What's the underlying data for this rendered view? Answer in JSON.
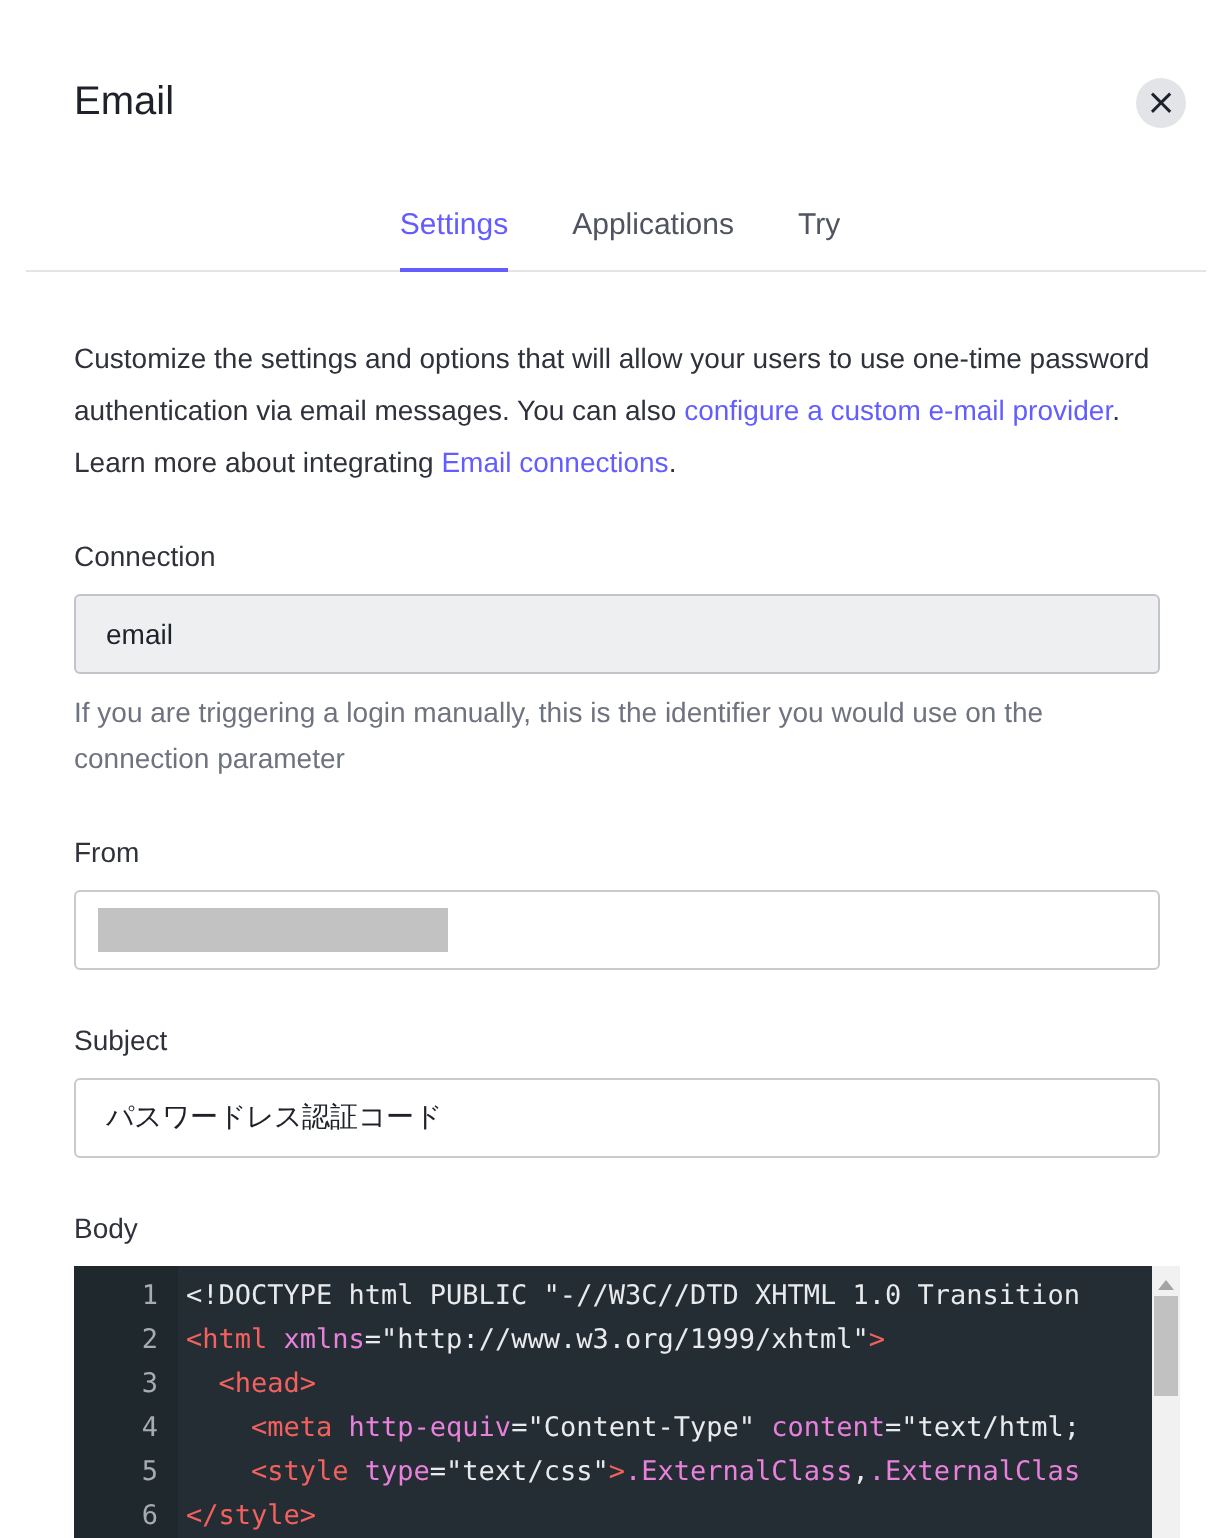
{
  "dialog": {
    "title": "Email",
    "close_label": "×"
  },
  "tabs": [
    {
      "label": "Settings",
      "selected": true
    },
    {
      "label": "Applications",
      "selected": false
    },
    {
      "label": "Try",
      "selected": false
    }
  ],
  "description": {
    "parts": [
      {
        "kind": "text",
        "text": "Customize the settings and options that will allow your users to use one-time password authentication via email messages. You can also "
      },
      {
        "kind": "link",
        "text": "configure a custom e-mail provider"
      },
      {
        "kind": "text",
        "text": ". Learn more about integrating "
      },
      {
        "kind": "link",
        "text": "Email connections"
      },
      {
        "kind": "text",
        "text": "."
      }
    ]
  },
  "fields": [
    {
      "kind": "input",
      "label": "Connection",
      "value": "email",
      "disabled": true,
      "help": "If you are triggering a login manually, this is the identifier you would use on the connection parameter"
    },
    {
      "kind": "redacted",
      "label": "From",
      "disabled": false
    },
    {
      "kind": "input",
      "label": "Subject",
      "value": "パスワードレス認証コード",
      "disabled": false
    },
    {
      "kind": "code",
      "label": "Body",
      "lines": [
        {
          "number": "1",
          "tokens": [
            {
              "kind": "plain",
              "text": "<!DOCTYPE html PUBLIC \"-//W3C//DTD XHTML 1.0 Transition"
            }
          ]
        },
        {
          "number": "2",
          "tokens": [
            {
              "kind": "tag",
              "text": "<html "
            },
            {
              "kind": "attr",
              "text": "xmlns"
            },
            {
              "kind": "plain",
              "text": "=\"http://www.w3.org/1999/xhtml\""
            },
            {
              "kind": "tag",
              "text": ">"
            }
          ],
          "children": [
            {
              "number": "3",
              "tokens": [
                {
                  "kind": "tag",
                  "text": "<head>"
                }
              ],
              "children": [
                {
                  "number": "4",
                  "tokens": [
                    {
                      "kind": "tag",
                      "text": "<meta "
                    },
                    {
                      "kind": "attr",
                      "text": "http-equiv"
                    },
                    {
                      "kind": "plain",
                      "text": "=\"Content-Type\" "
                    },
                    {
                      "kind": "attr",
                      "text": "content"
                    },
                    {
                      "kind": "plain",
                      "text": "=\"text/html;"
                    }
                  ]
                },
                {
                  "number": "5",
                  "tokens": [
                    {
                      "kind": "tag",
                      "text": "<style "
                    },
                    {
                      "kind": "attr",
                      "text": "type"
                    },
                    {
                      "kind": "plain",
                      "text": "=\"text/css\""
                    },
                    {
                      "kind": "tag",
                      "text": ">"
                    },
                    {
                      "kind": "attr",
                      "text": ".ExternalClass"
                    },
                    {
                      "kind": "plain",
                      "text": ","
                    },
                    {
                      "kind": "attr",
                      "text": ".ExternalClas"
                    }
                  ]
                }
              ]
            }
          ]
        },
        {
          "number": "6",
          "tokens": [
            {
              "kind": "tag",
              "text": "</style>"
            }
          ]
        }
      ]
    }
  ]
}
